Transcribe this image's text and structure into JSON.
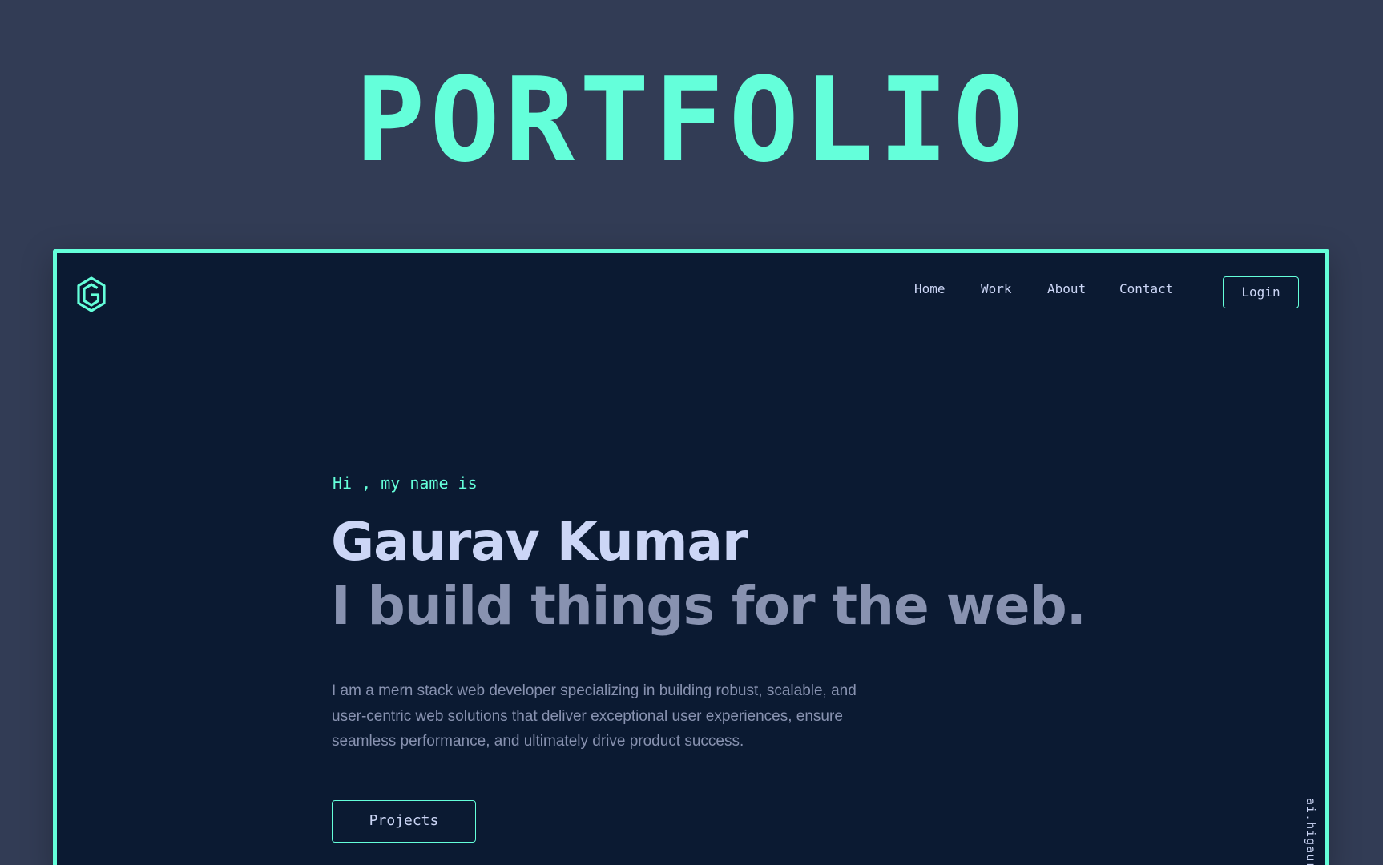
{
  "banner": {
    "title": "PORTFOLIO"
  },
  "colors": {
    "accent": "#64ffda",
    "background": "#0b1a32",
    "outer_background": "#323c55",
    "heading": "#ccd6f6",
    "muted": "#8892b0"
  },
  "header": {
    "logo_icon": "hexagon-g-logo-icon",
    "nav": [
      {
        "label": "Home"
      },
      {
        "label": "Work"
      },
      {
        "label": "About"
      },
      {
        "label": "Contact"
      }
    ],
    "login_label": "Login"
  },
  "hero": {
    "greeting": "Hi , my name is",
    "name": "Gaurav Kumar",
    "tagline": "I build things for the web.",
    "description": "I am a mern stack web developer specializing in building robust, scalable, and user-centric web solutions that deliver exceptional user experiences, ensure seamless performance, and ultimately drive product success.",
    "cta_label": "Projects"
  },
  "side": {
    "email": "ai.higaurav"
  }
}
